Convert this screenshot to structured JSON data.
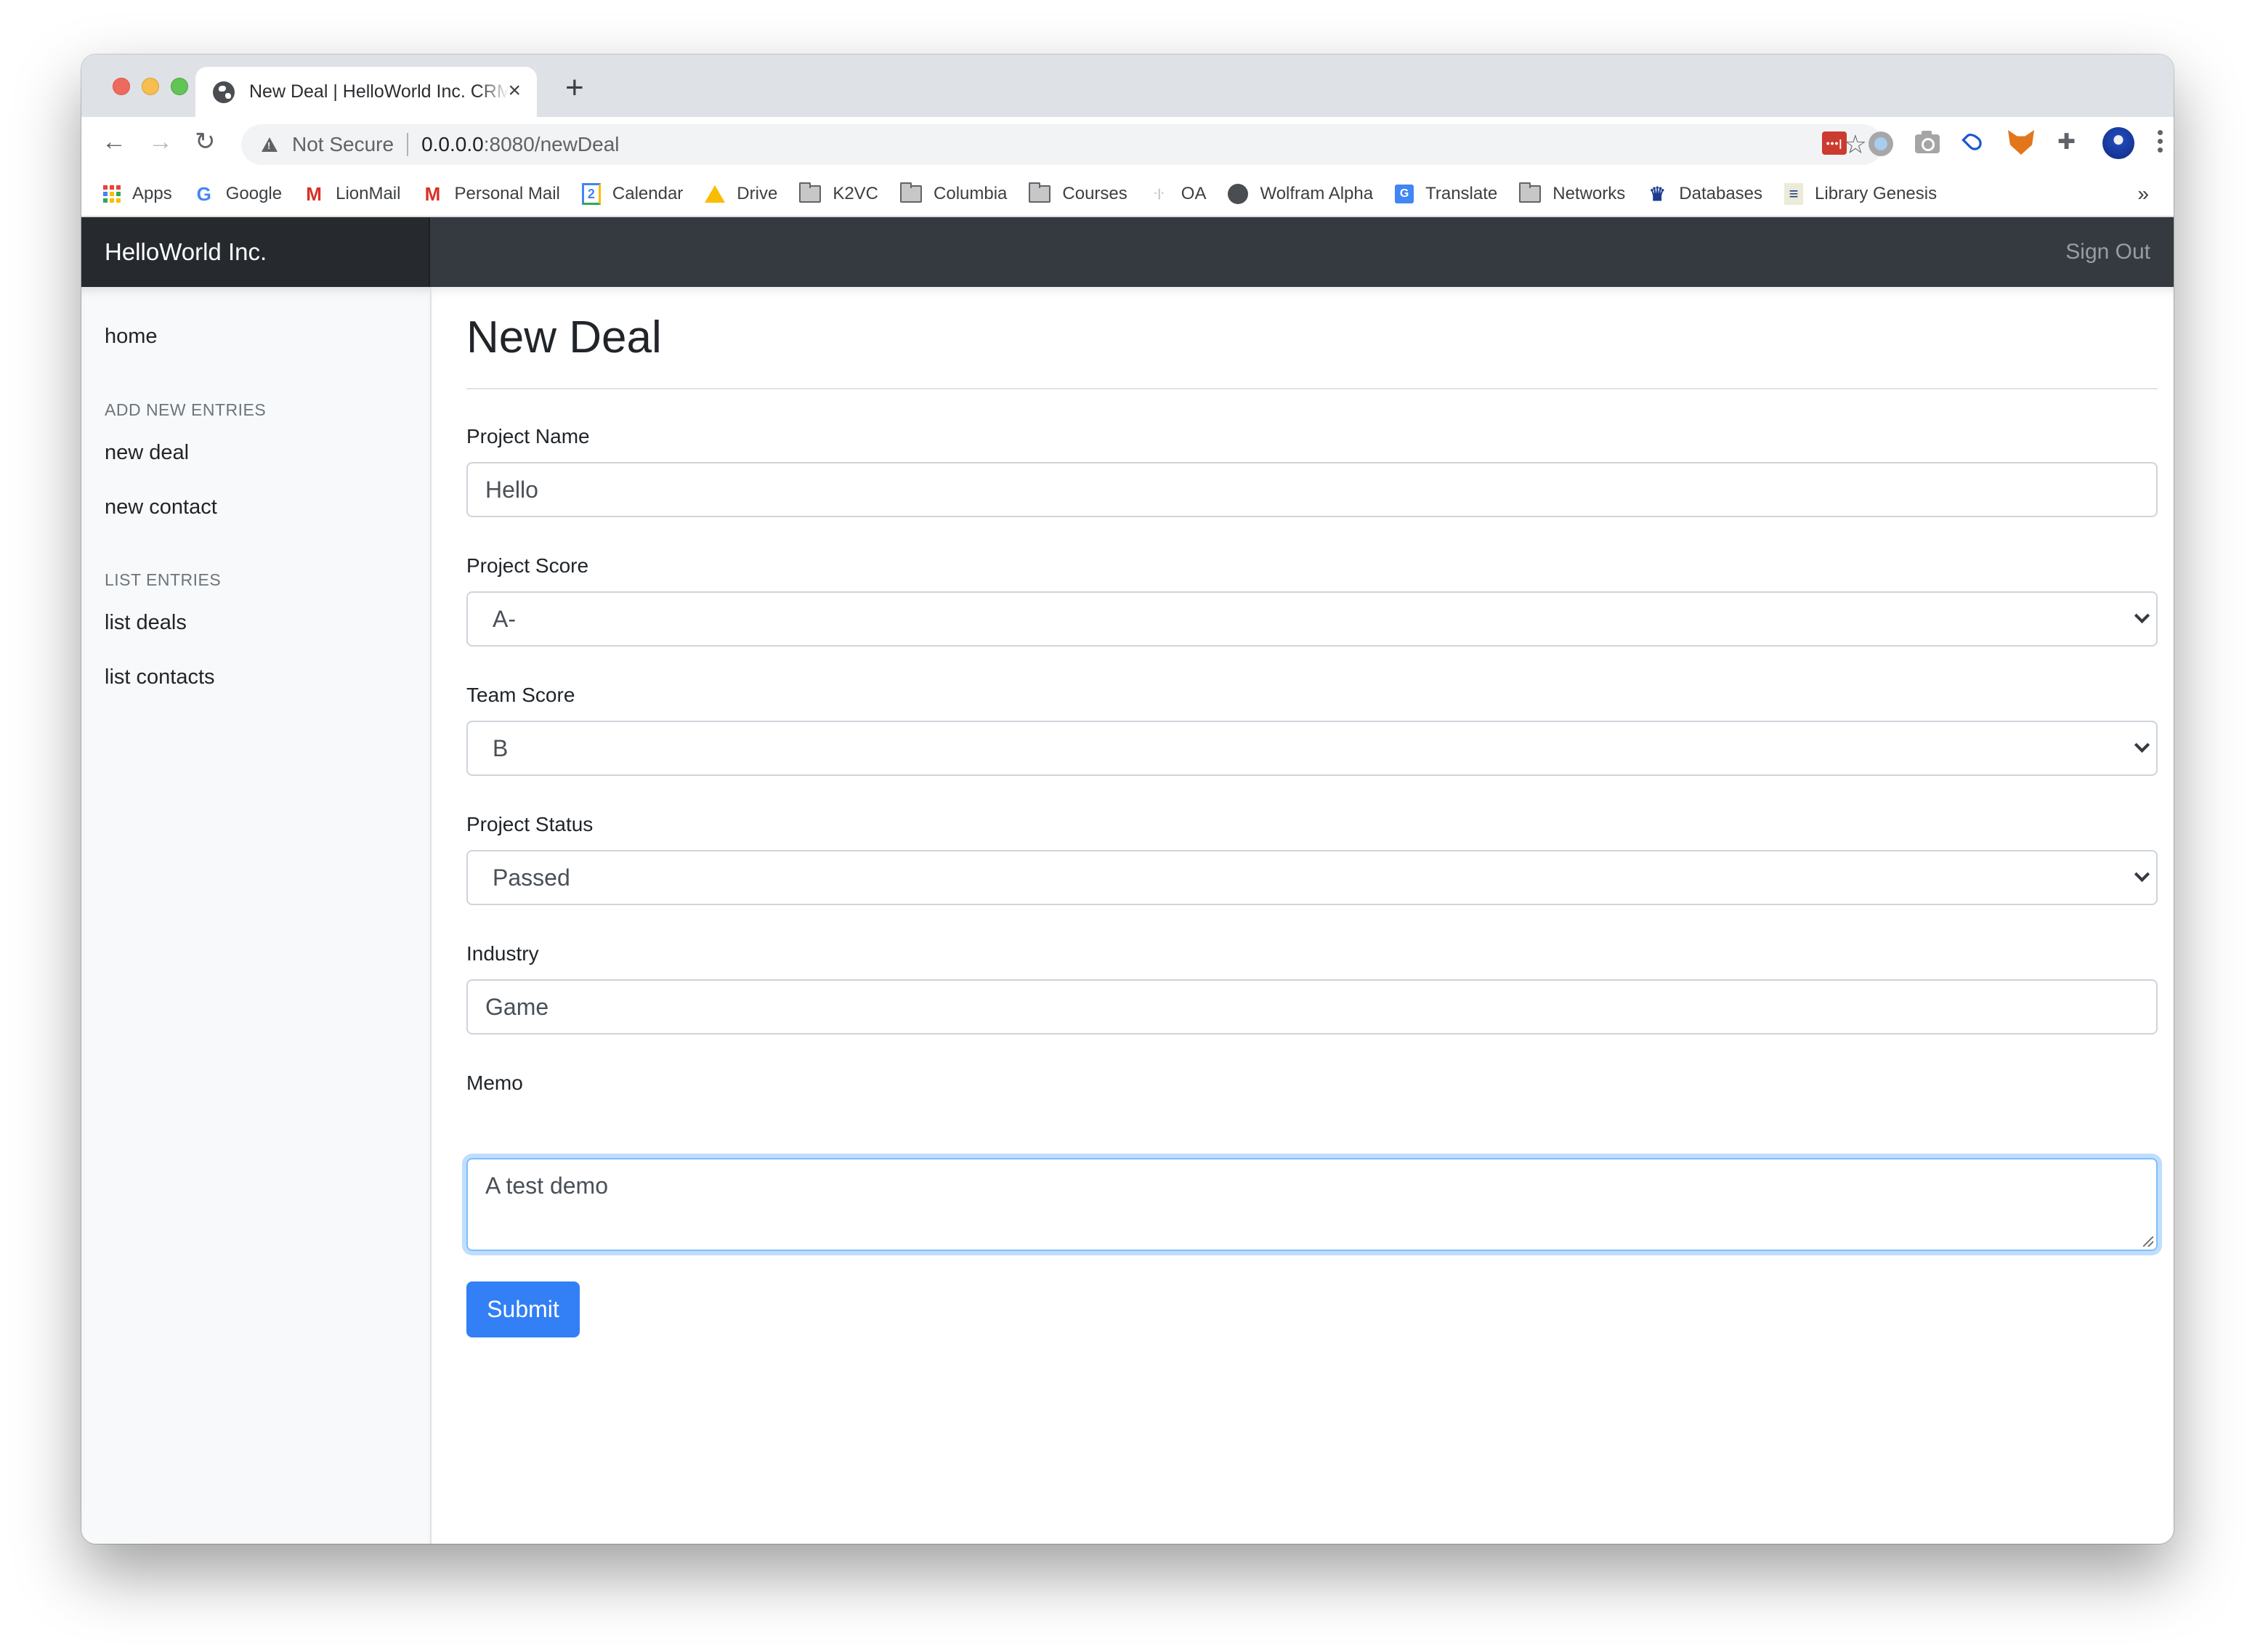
{
  "browser": {
    "tab": {
      "title": "New Deal | HelloWorld Inc. CRM",
      "favicon": "globe-icon",
      "close_icon": "×"
    },
    "new_tab_icon": "+",
    "nav": {
      "back_icon": "←",
      "forward_icon": "→",
      "reload_icon": "↻"
    },
    "omnibox": {
      "security_label": "Not Secure",
      "url_host": "0.0.0.0",
      "url_path": ":8080/newDeal",
      "star_icon": "☆"
    },
    "extensions": [
      "lastpass-icon",
      "circle-extension-icon",
      "screenshot-icon",
      "raindrop-icon",
      "metamask-icon",
      "extensions-puzzle-icon",
      "profile-avatar",
      "menu-kebab-icon"
    ],
    "lastpass_glyph": "•••|",
    "puzzle_glyph": "✚",
    "bookmarks": [
      {
        "label": "Apps",
        "icon": "apps-grid-icon"
      },
      {
        "label": "Google",
        "icon": "google-icon"
      },
      {
        "label": "LionMail",
        "icon": "gmail-icon"
      },
      {
        "label": "Personal Mail",
        "icon": "gmail-icon"
      },
      {
        "label": "Calendar",
        "icon": "calendar-icon"
      },
      {
        "label": "Drive",
        "icon": "drive-icon"
      },
      {
        "label": "K2VC",
        "icon": "folder-icon"
      },
      {
        "label": "Columbia",
        "icon": "folder-icon"
      },
      {
        "label": "Courses",
        "icon": "folder-icon"
      },
      {
        "label": "OA",
        "icon": "dots-icon"
      },
      {
        "label": "Wolfram Alpha",
        "icon": "globe-icon"
      },
      {
        "label": "Translate",
        "icon": "translate-icon"
      },
      {
        "label": "Networks",
        "icon": "folder-icon"
      },
      {
        "label": "Databases",
        "icon": "crown-icon"
      },
      {
        "label": "Library Genesis",
        "icon": "libgen-icon"
      }
    ],
    "bookmarks_overflow": "»",
    "glyphs": {
      "google": "G",
      "gmail": "M",
      "calendar": "2",
      "dots": "·|·",
      "translate": "G",
      "crown": "♛",
      "libgen": "≡"
    }
  },
  "app": {
    "brand": "HelloWorld Inc.",
    "sign_out": "Sign Out",
    "sidebar": {
      "home": "home",
      "sections": [
        {
          "heading": "ADD NEW ENTRIES",
          "items": [
            "new deal",
            "new contact"
          ]
        },
        {
          "heading": "LIST ENTRIES",
          "items": [
            "list deals",
            "list contacts"
          ]
        }
      ]
    },
    "page_title": "New Deal",
    "form": {
      "project_name": {
        "label": "Project Name",
        "value": "Hello"
      },
      "project_score": {
        "label": "Project Score",
        "value": "A-"
      },
      "team_score": {
        "label": "Team Score",
        "value": "B"
      },
      "project_status": {
        "label": "Project Status",
        "value": "Passed"
      },
      "industry": {
        "label": "Industry",
        "value": "Game"
      },
      "memo": {
        "label": "Memo",
        "value": "A test demo"
      },
      "submit_label": "Submit"
    },
    "colors": {
      "primary": "#327ff6",
      "navbar": "#343a40",
      "brand_bg": "#262a2f",
      "sidebar_bg": "#f8f9fa",
      "focus": "#80bdff"
    }
  }
}
